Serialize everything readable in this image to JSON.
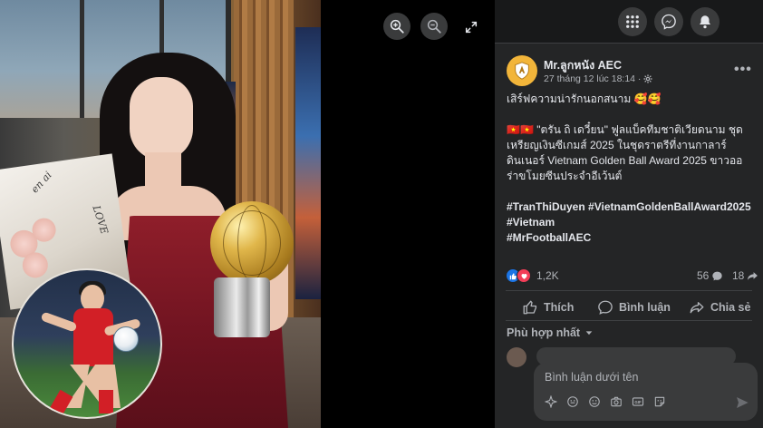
{
  "post": {
    "page_name": "Mr.ลูกหนัง AEC",
    "timestamp": "27 tháng 12 lúc 18:14 ·",
    "caption": "เสิร์ฟความน่ารักนอกสนาม 🥰🥰",
    "body_lines": [
      "🇻🇳🇻🇳 \"ตรัน ถิ เดวี๋ยน\" ฟูลแบ็คทีมชาติเวียดนาม ชุด",
      "เหรียญเงินซีเกมส์ 2025 ในชุดราตรีที่งานกาลาร์",
      "ดินเนอร์ Vietnam Golden Ball Award 2025 ขาวออ",
      "ร่าขโมยซีนประจำอีเว้นต์"
    ],
    "hashtags": [
      "#TranThiDuyen #VietnamGoldenBallAward2025",
      "#Vietnam",
      "#MrFootballAEC"
    ]
  },
  "stats": {
    "reaction_count": "1,2K",
    "comment_count": "56",
    "share_count": "18"
  },
  "actions": {
    "like": "Thích",
    "comment": "Bình luận",
    "share": "Chia sẻ"
  },
  "comments": {
    "sort_label": "Phù hợp nhất",
    "composer_placeholder": "Bình luận dưới tên"
  },
  "photo": {
    "wrap_text_1": "en ai",
    "wrap_text_2": "LOVE"
  },
  "colors": {
    "panel_bg": "#242526",
    "topbar_bg": "#18191a",
    "accent_like": "#1b74e4",
    "accent_love": "#f33e58",
    "text_primary": "#e4e6eb",
    "text_secondary": "#b0b3b8"
  },
  "icons": {
    "zoom_in": "zoom-in-icon",
    "zoom_out": "zoom-out-icon",
    "fullscreen": "fullscreen-icon",
    "menu": "grid-menu-icon",
    "messenger": "messenger-icon",
    "notifications": "bell-icon"
  }
}
